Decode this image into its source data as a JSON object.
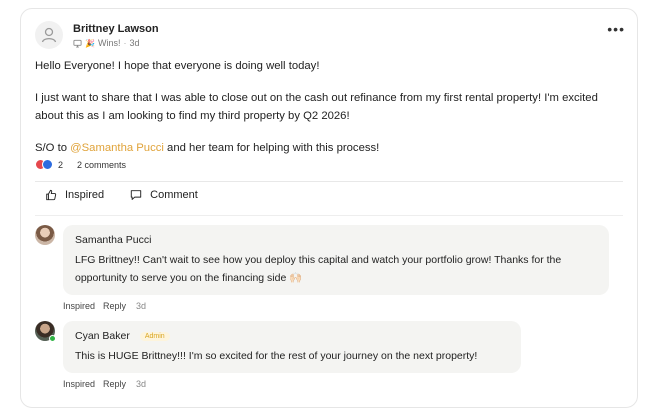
{
  "post": {
    "author": "Brittney Lawson",
    "badge_text": "Wins!",
    "time": "3d",
    "paragraphs": [
      "Hello Everyone! I hope that everyone is doing well today!",
      "I just want to share that I was able to close out on the cash out refinance from my first rental property! I'm excited about this as I am looking to find my third property by Q2 2026!"
    ],
    "shoutout_prefix": "S/O to ",
    "shoutout_mention": "@Samantha Pucci",
    "shoutout_suffix": " and her team for helping with this process!",
    "reaction_count": "2",
    "comments_count": "2 comments"
  },
  "actions": {
    "inspired_label": "Inspired",
    "comment_label": "Comment"
  },
  "comments": [
    {
      "name": "Samantha Pucci",
      "badge": "",
      "text": "LFG Brittney!! Can't wait to see how you deploy this capital and watch your portfolio grow! Thanks for the opportunity to serve you on the financing side 🙌🏻",
      "inspired": "Inspired",
      "reply": "Reply",
      "time": "3d"
    },
    {
      "name": "Cyan Baker",
      "badge": "Admin",
      "text": "This is HUGE Brittney!!! I'm so excited for the rest of your journey on the next property!",
      "inspired": "Inspired",
      "reply": "Reply",
      "time": "3d"
    }
  ],
  "colors": {
    "mention": "#e0a33a",
    "online": "#2fb344",
    "reaction_heart": "#e5484d",
    "reaction_like": "#2d6cdf"
  }
}
